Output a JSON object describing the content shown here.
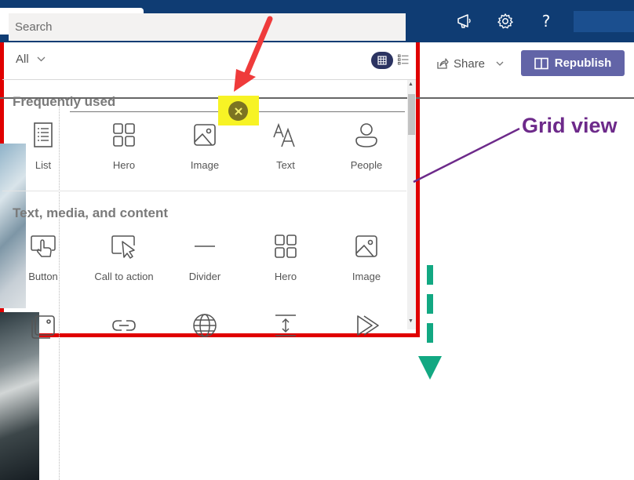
{
  "topbar": {
    "icons": [
      "megaphone-icon",
      "gear-icon",
      "help-icon"
    ],
    "help_glyph": "?"
  },
  "command_bar": {
    "share_label": "Share",
    "republish_label": "Republish"
  },
  "annotation": {
    "grid_view_label": "Grid view",
    "colors": {
      "arrow_red": "#ef3b3b",
      "label_purple": "#6d2a8a",
      "scroll_arrow_teal": "#12a882",
      "highlight_yellow": "#f7f325",
      "panel_border_red": "#e00000"
    }
  },
  "toolbox": {
    "search_placeholder": "Search",
    "filter_value": "All",
    "view_mode": "grid",
    "sections": [
      {
        "title": "Frequently used",
        "items": [
          {
            "label": "List",
            "icon": "list-icon"
          },
          {
            "label": "Hero",
            "icon": "hero-icon"
          },
          {
            "label": "Image",
            "icon": "image-icon"
          },
          {
            "label": "Text",
            "icon": "text-icon"
          },
          {
            "label": "People",
            "icon": "people-icon"
          }
        ]
      },
      {
        "title": "Text, media, and content",
        "items": [
          {
            "label": "Button",
            "icon": "button-icon"
          },
          {
            "label": "Call to action",
            "icon": "call-to-action-icon"
          },
          {
            "label": "Divider",
            "icon": "divider-icon"
          },
          {
            "label": "Hero",
            "icon": "hero-icon"
          },
          {
            "label": "Image",
            "icon": "image-icon"
          }
        ]
      }
    ],
    "partial_row_icons": [
      "image-gallery-icon",
      "link-icon",
      "globe-icon",
      "spacer-icon",
      "stream-icon"
    ]
  },
  "theme": {
    "suite_bar": "#0f3c73",
    "republish": "#6264a7"
  }
}
